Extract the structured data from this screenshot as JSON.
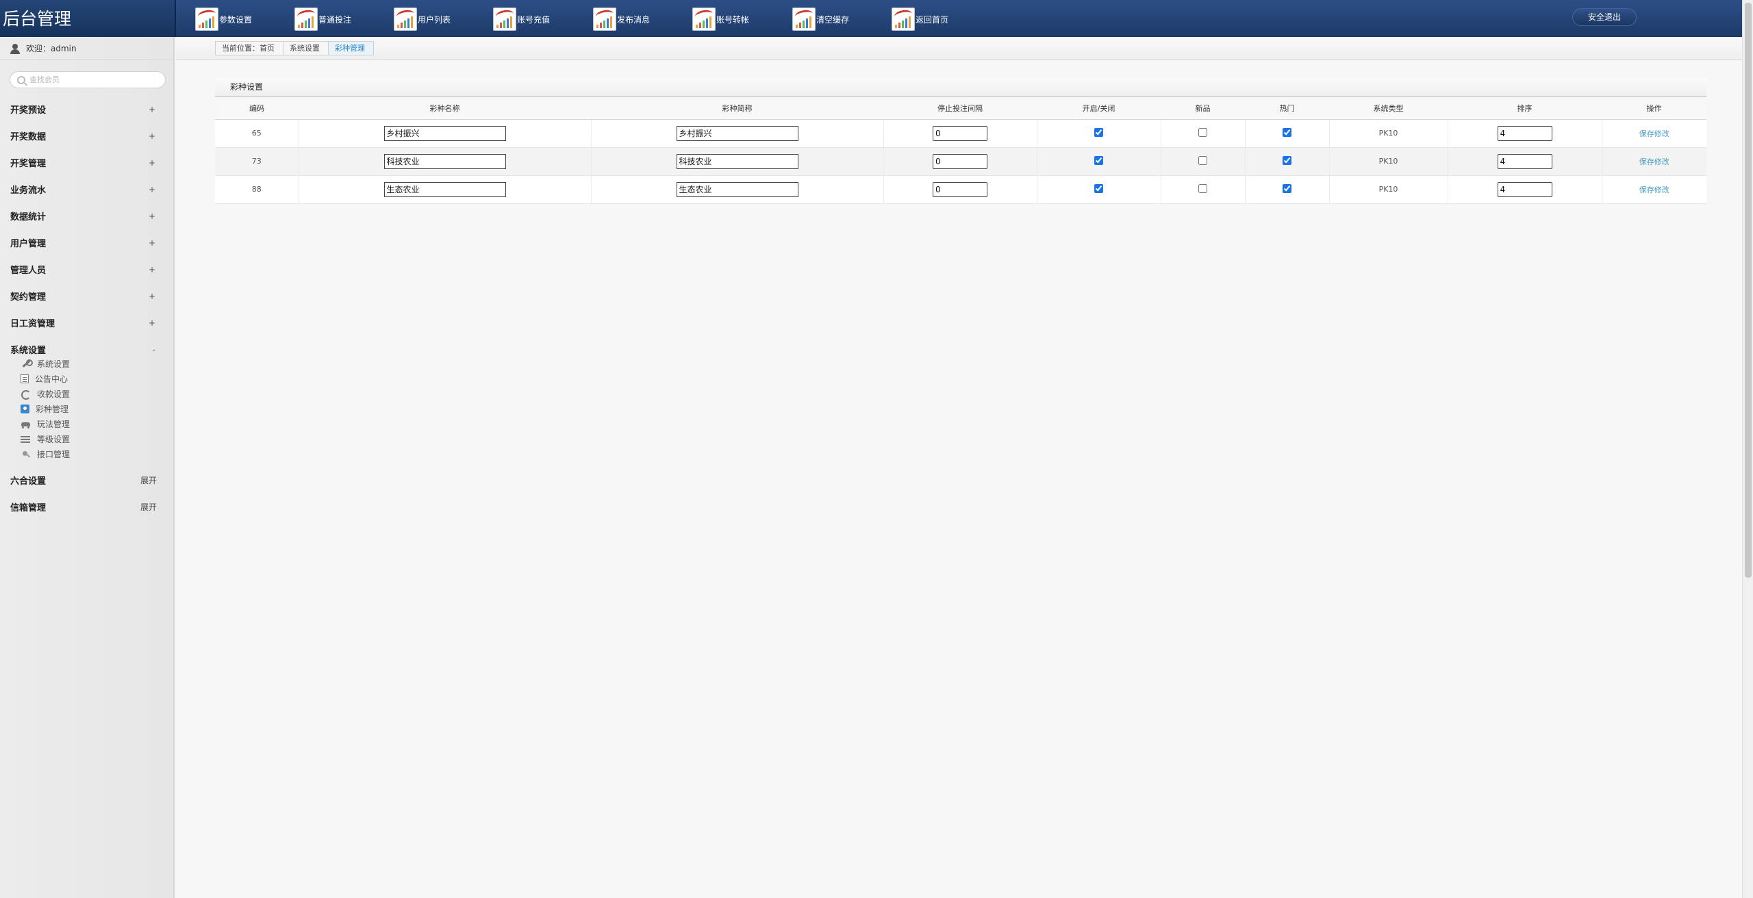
{
  "app": {
    "title": "后台管理"
  },
  "topnav": {
    "items": [
      {
        "label": "参数设置"
      },
      {
        "label": "普通投注"
      },
      {
        "label": "用户列表"
      },
      {
        "label": "账号充值"
      },
      {
        "label": "发布消息"
      },
      {
        "label": "账号转帐"
      },
      {
        "label": "清空缓存"
      },
      {
        "label": "返回首页"
      }
    ],
    "logout_label": "安全退出"
  },
  "sidebar": {
    "welcome": "欢迎：admin",
    "search_placeholder": "查找会员",
    "menu": [
      {
        "label": "开奖预设",
        "sign": "+"
      },
      {
        "label": "开奖数据",
        "sign": "+"
      },
      {
        "label": "开奖管理",
        "sign": "+"
      },
      {
        "label": "业务流水",
        "sign": "+"
      },
      {
        "label": "数据统计",
        "sign": "+"
      },
      {
        "label": "用户管理",
        "sign": "+"
      },
      {
        "label": "管理人员",
        "sign": "+"
      },
      {
        "label": "契约管理",
        "sign": "+"
      },
      {
        "label": "日工资管理",
        "sign": "+"
      },
      {
        "label": "系统设置",
        "sign": "-"
      }
    ],
    "submenu": [
      {
        "label": "系统设置",
        "icon": "wrench-icon"
      },
      {
        "label": "公告中心",
        "icon": "document-icon"
      },
      {
        "label": "收款设置",
        "icon": "refresh-icon"
      },
      {
        "label": "彩种管理",
        "icon": "lottery-icon"
      },
      {
        "label": "玩法管理",
        "icon": "car-icon"
      },
      {
        "label": "等级设置",
        "icon": "level-icon"
      },
      {
        "label": "接口管理",
        "icon": "plug-icon"
      }
    ],
    "menu_after": [
      {
        "label": "六合设置",
        "sign": "展开"
      },
      {
        "label": "信箱管理",
        "sign": "展开"
      }
    ]
  },
  "breadcrumb": {
    "items": [
      "当前位置：首页",
      "系统设置",
      "彩种管理"
    ]
  },
  "panel": {
    "title": "彩种设置",
    "columns": [
      "编码",
      "彩种名称",
      "彩种简称",
      "停止投注间隔",
      "开启/关闭",
      "新品",
      "热门",
      "系统类型",
      "排序",
      "操作"
    ],
    "rows": [
      {
        "code": "65",
        "name": "乡村振兴",
        "short": "乡村振兴",
        "interval": "0",
        "enabled": true,
        "is_new": false,
        "hot": true,
        "type": "PK10",
        "sort": "4",
        "action": "保存修改"
      },
      {
        "code": "73",
        "name": "科技农业",
        "short": "科技农业",
        "interval": "0",
        "enabled": true,
        "is_new": false,
        "hot": true,
        "type": "PK10",
        "sort": "4",
        "action": "保存修改"
      },
      {
        "code": "88",
        "name": "生态农业",
        "short": "生态农业",
        "interval": "0",
        "enabled": true,
        "is_new": false,
        "hot": true,
        "type": "PK10",
        "sort": "4",
        "action": "保存修改"
      }
    ]
  },
  "colors": {
    "header": "#1d3a69",
    "link": "#4a9cc7",
    "checkbox": "#1a73e8"
  }
}
